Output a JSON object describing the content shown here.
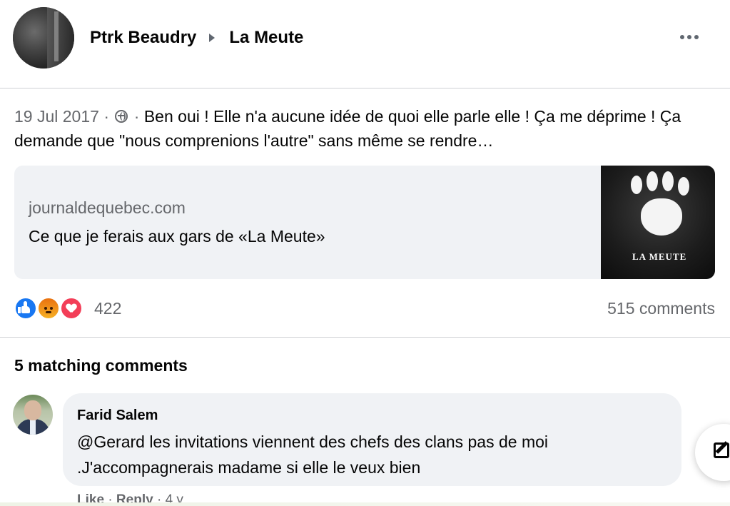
{
  "post": {
    "author": "Ptrk Beaudry",
    "group": "La Meute",
    "date": "19 Jul 2017",
    "separator1": "·",
    "separator2": "·",
    "text": "Ben oui ! Elle n'a aucune idée de quoi elle parle elle ! Ça me déprime ! Ça demande que \"nous comprenions l'autre\" sans même se rendre…",
    "privacy_icon": "globe-icon"
  },
  "link": {
    "domain": "journaldequebec.com",
    "title": "Ce que je ferais aux gars de «La Meute»",
    "thumbnail_label": "LA MEUTE"
  },
  "reactions": {
    "types": [
      "like",
      "angry",
      "love"
    ],
    "count": "422",
    "comments_count": "515 comments",
    "colors": {
      "like": "#1877f2",
      "angry": "#f7b125",
      "love": "#f33e58"
    }
  },
  "comments_section": {
    "title": "5 matching comments",
    "comments": [
      {
        "author": "Farid Salem",
        "text": "@Gerard les invitations viennent des chefs des clans pas de moi .J'accompagnerais madame si elle le veux bien",
        "like_label": "Like",
        "reply_label": "Reply",
        "time": "4 y"
      }
    ]
  }
}
